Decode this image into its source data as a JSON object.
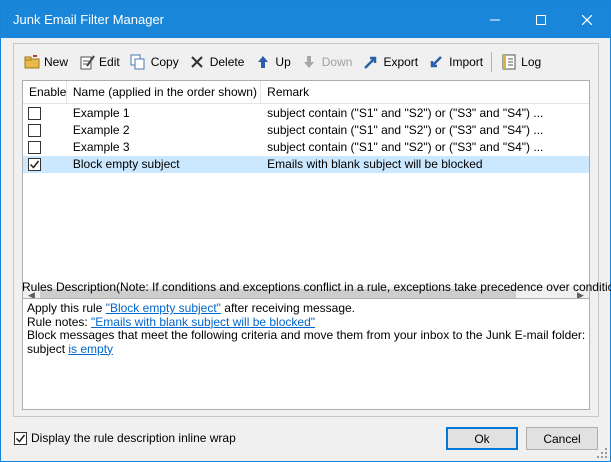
{
  "window": {
    "title": "Junk Email Filter Manager",
    "accent": "#1a86d9"
  },
  "toolbar": {
    "new": "New",
    "edit": "Edit",
    "copy": "Copy",
    "delete": "Delete",
    "up": "Up",
    "down": "Down",
    "export": "Export",
    "import": "Import",
    "log": "Log"
  },
  "list": {
    "headers": {
      "enable": "Enable",
      "name": "Name (applied in the order shown)",
      "remark": "Remark"
    },
    "rows": [
      {
        "enabled": false,
        "name": "Example 1",
        "remark": "subject contain  (\"S1\" and \"S2\") or (\"S3\" and \"S4\") ..."
      },
      {
        "enabled": false,
        "name": "Example 2",
        "remark": "subject contain  (\"S1\" and \"S2\") or (\"S3\" and \"S4\") ..."
      },
      {
        "enabled": false,
        "name": "Example 3",
        "remark": "subject contain  (\"S1\" and \"S2\") or (\"S3\" and \"S4\") ..."
      },
      {
        "enabled": true,
        "name": "Block empty subject",
        "remark": "Emails with blank subject will be blocked",
        "selected": true
      }
    ]
  },
  "rules": {
    "label": "Rules Description(Note: If conditions and exceptions conflict in a rule, exceptions take precedence over conditions)",
    "line1_prefix": "Apply this rule ",
    "line1_link": "\"Block empty subject\"",
    "line1_suffix": " after receiving message.",
    "line2_prefix": "Rule notes: ",
    "line2_link": "\"Emails with blank subject will be blocked\"",
    "line3": "Block messages that meet the following criteria and move them from your inbox to the Junk E-mail folder:",
    "line4_prefix": "subject ",
    "line4_link": "is empty"
  },
  "footer": {
    "wrap_label": "Display the rule description inline wrap",
    "wrap_checked": true,
    "ok": "Ok",
    "cancel": "Cancel"
  }
}
